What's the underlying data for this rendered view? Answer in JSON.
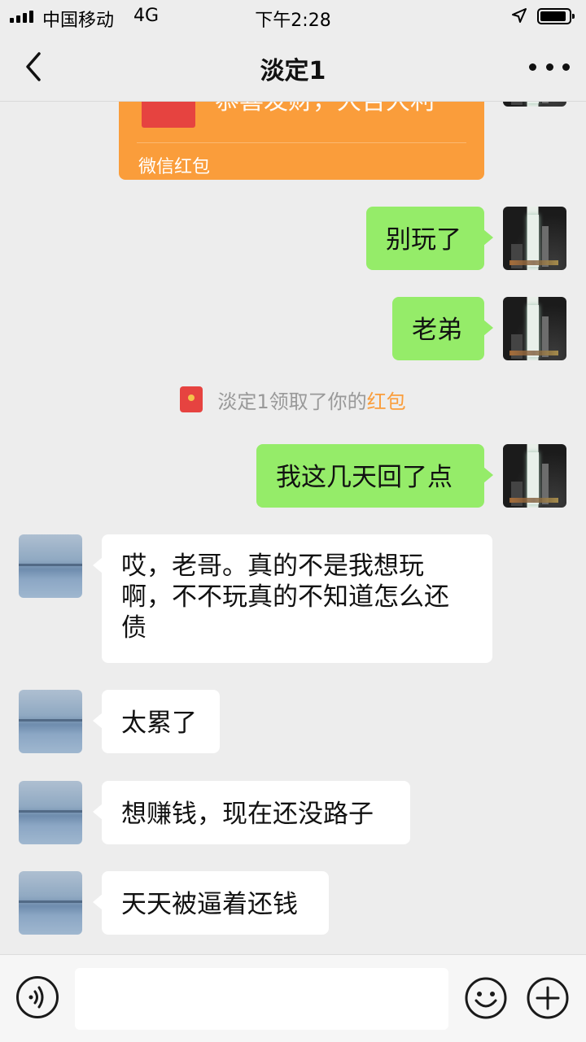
{
  "status_bar": {
    "carrier": "中国移动",
    "network": "4G",
    "time": "下午2:28",
    "battery_level": 0.9
  },
  "nav": {
    "title": "淡定1",
    "back_icon": "chevron-left-icon",
    "more_icon": "more-dots-icon"
  },
  "messages": {
    "red_packet": {
      "text_partial": "恭喜发财，大吉大利",
      "label": "微信红包"
    },
    "sent": [
      {
        "text": "别玩了"
      },
      {
        "text": "老弟"
      },
      {
        "text": "我这几天回了点"
      }
    ],
    "system": {
      "prefix": "淡定1领取了你的",
      "link": "红包"
    },
    "received": [
      {
        "text": "哎，老哥。真的不是我想玩啊，不不玩真的不知道怎么还债"
      },
      {
        "text": "太累了"
      },
      {
        "text": "想赚钱，现在还没路子"
      },
      {
        "text": "天天被逼着还钱"
      }
    ]
  },
  "input_bar": {
    "value": "",
    "voice_icon": "voice-icon",
    "emoji_icon": "emoji-icon",
    "plus_icon": "plus-icon"
  },
  "colors": {
    "sent_bubble": "#95ec69",
    "received_bubble": "#ffffff",
    "red_packet": "#fa9d3b",
    "background": "#ededed"
  }
}
